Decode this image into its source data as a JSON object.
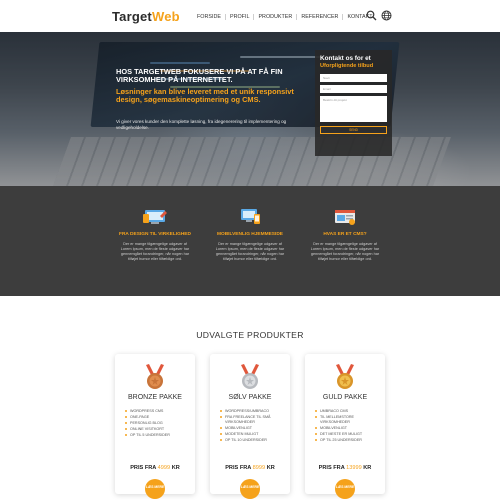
{
  "header": {
    "logo_part1": "Target",
    "logo_part2": "Web",
    "nav": [
      "FORSIDE",
      "PROFIL",
      "PRODUKTER",
      "REFERENCER",
      "KONTAKT"
    ]
  },
  "hero": {
    "title": "HOS TARGETWEB FOKUSERE VI PÅ AT FÅ FIN VIRKSOMHED PÅ INTERNETTET.",
    "subtitle": "Løsninger kan blive leveret med et unik responsivt design, søgemaskineoptimering og CMS.",
    "body": "Vi giver vores kunder den komplette løsning, fra idegenerering til implementering og vedligeholdelse."
  },
  "contact": {
    "title": "Kontakt os for et",
    "subtitle": "Uforpligtende tilbud",
    "name_placeholder": "Navn",
    "email_placeholder": "Email",
    "message_placeholder": "Beskriv dit projekt",
    "send_label": "SEND"
  },
  "features": [
    {
      "icon": "design-screen-icon",
      "title": "FRA DESIGN TIL VIRKELIGHED",
      "text": "Der er mange tilgængelige udgaver af Lorem Ipsum, men de fleste udgaver har gennemgået forandringer, når nogen har tilføjet humor eller tilfældige ord."
    },
    {
      "icon": "mobile-friendly-icon",
      "title": "MOBILVENLIG HJEMMESIDE",
      "text": "Der er mange tilgængelige udgaver af Lorem Ipsum, men de fleste udgaver har gennemgået forandringer, når nogen har tilføjet humor eller tilfældige ord."
    },
    {
      "icon": "cms-icon",
      "title": "HVAS ER ET CMS?",
      "text": "Der er mange tilgængelige udgaver af Lorem Ipsum, men de fleste udgaver har gennemgået forandringer, når nogen har tilføjet humor eller tilfældige ord."
    }
  ],
  "products": {
    "title": "UDVALGTE PRODUKTER",
    "cards": [
      {
        "name": "BRONZE PAKKE",
        "medal_color": "#c8743a",
        "ribbon_color": "#e0573c",
        "features": [
          "WORDPRESS CMS",
          "ONE-PAGE",
          "PERSONLIG BLOG",
          "ONLINE VISITKORT",
          "OP TIL 5 UNDERSIDER"
        ],
        "price_label": "PRIS FRA",
        "price_amount": "4999",
        "currency": "KR",
        "button": "LÆS MERE"
      },
      {
        "name": "SØLV PAKKE",
        "medal_color": "#c9cbcf",
        "ribbon_color": "#e0573c",
        "features": [
          "WORDPRESS/UMBRACO",
          "FRA FREELANCE TIL SMÅ VIRKSOMHEDER",
          "MOBILVENLIGT",
          "MODETEN MULIGT",
          "OP TIL 10 UNDERSIDER"
        ],
        "price_label": "PRIS FRA",
        "price_amount": "8999",
        "currency": "KR",
        "button": "LÆS MERE"
      },
      {
        "name": "GULD PAKKE",
        "medal_color": "#e2a52c",
        "ribbon_color": "#e0573c",
        "features": [
          "UMBRACO CMS",
          "TIL MELLEMSTORE VIRKSOMHEDER",
          "MOBILVENLIGT",
          "DET MESTE ER MULIGT",
          "OP TIL 25 UNDERSIDER"
        ],
        "price_label": "PRIS FRA",
        "price_amount": "13999",
        "currency": "KR",
        "button": "LÆS MERE"
      }
    ]
  },
  "colors": {
    "accent": "#f5a21b",
    "dark": "#3d3d3d"
  }
}
